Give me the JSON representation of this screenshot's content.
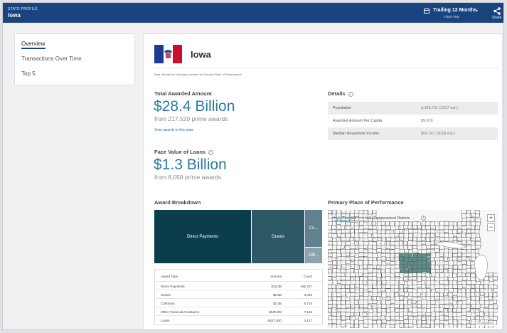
{
  "header": {
    "eyebrow": "STATE PROFILE",
    "title": "Iowa",
    "fiscal_year": {
      "value": "Trailing 12 Months",
      "label": "Fiscal Year"
    },
    "share_label": "Share",
    "background": "#1a4480"
  },
  "sidebar": {
    "items": [
      {
        "label": "Overview",
        "active": true
      },
      {
        "label": "Transactions Over Time",
        "active": false
      },
      {
        "label": "Top 5",
        "active": false
      }
    ]
  },
  "state": {
    "name": "Iowa",
    "note": "Note: All data on this page is based on Primary Place of Performance."
  },
  "total_awarded": {
    "label": "Total Awarded Amount",
    "value": "$28.4 Billion",
    "sub": "from 217,520 prime awards",
    "link": "View awards to this state"
  },
  "face_value": {
    "label": "Face Value of Loans",
    "value": "$1.3 Billion",
    "sub": "from 8,058 prime awards"
  },
  "details": {
    "label": "Details",
    "rows": [
      {
        "key": "Population",
        "value": "3,145,711 (2017 est.)"
      },
      {
        "key": "Awarded Amount Per Capita",
        "value": "$9,016"
      },
      {
        "key": "Median Household Income",
        "value": "$59,247 (2018 est.)"
      }
    ]
  },
  "award_breakdown": {
    "label": "Award Breakdown",
    "tiles": [
      {
        "label": "Direct Payments",
        "color": "#0b3d4c"
      },
      {
        "label": "Grants",
        "color": "#2f5866"
      },
      {
        "label": "Co...",
        "color": "#5f8190"
      },
      {
        "label": "Oth...",
        "color": "#8aa3ae"
      }
    ],
    "table": {
      "headers": [
        "Award Type",
        "Amount",
        "Count"
      ],
      "rows": [
        [
          "Direct Payments",
          "$16.3B",
          "166,337"
        ],
        [
          "Grants",
          "$6.6B",
          "3,010"
        ],
        [
          "Contracts",
          "$2.4B",
          "8,715"
        ],
        [
          "Other Financial Assistance",
          "$640.0M",
          "7,166"
        ],
        [
          "Loans",
          "-$427,830",
          "3,127"
        ]
      ]
    }
  },
  "map": {
    "label": "Primary Place of Performance",
    "tabs": [
      "U.S. Counties",
      "U.S. Congressional Districts"
    ],
    "zoom_in": "+",
    "zoom_out": "−",
    "attribution": "© mapbox",
    "highlight_color": "#5c8f88"
  }
}
